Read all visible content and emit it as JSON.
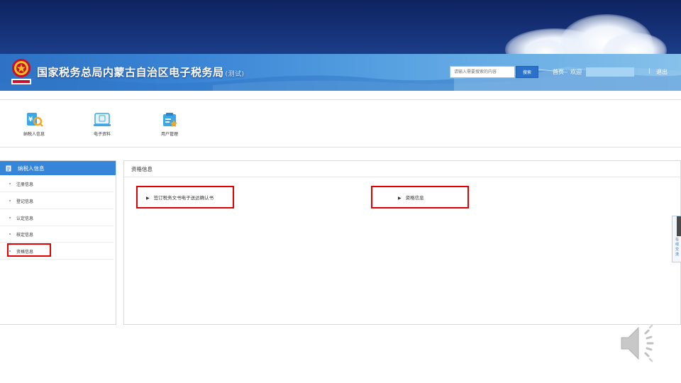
{
  "header": {
    "site_title": "国家税务总局内蒙古自治区电子税务局",
    "site_title_tag": "(测试)",
    "search_placeholder": "请输入需要搜索的内容",
    "search_button": "搜索",
    "nav_home": "首页",
    "nav_welcome": "欢迎",
    "nav_separator": "|",
    "nav_logout": "退出"
  },
  "quick_menu": {
    "items": [
      {
        "label": "纳税人信息",
        "icon": "taxpayer-info-icon"
      },
      {
        "label": "电子资料",
        "icon": "electronic-docs-icon"
      },
      {
        "label": "用户管理",
        "icon": "user-management-icon"
      }
    ]
  },
  "sidebar": {
    "title": "纳税人信息",
    "items": [
      {
        "label": "注册信息"
      },
      {
        "label": "登记信息"
      },
      {
        "label": "认定信息"
      },
      {
        "label": "核定信息"
      },
      {
        "label": "资格信息"
      }
    ]
  },
  "main": {
    "title": "资格信息",
    "links": [
      {
        "label": "签订税务文书电子送达确认书"
      },
      {
        "label": "资格信息"
      }
    ]
  },
  "side_tab": {
    "label": "在线交流"
  },
  "colors": {
    "accent": "#3585d9",
    "highlight": "#e00000",
    "top_band": "#142e72"
  }
}
